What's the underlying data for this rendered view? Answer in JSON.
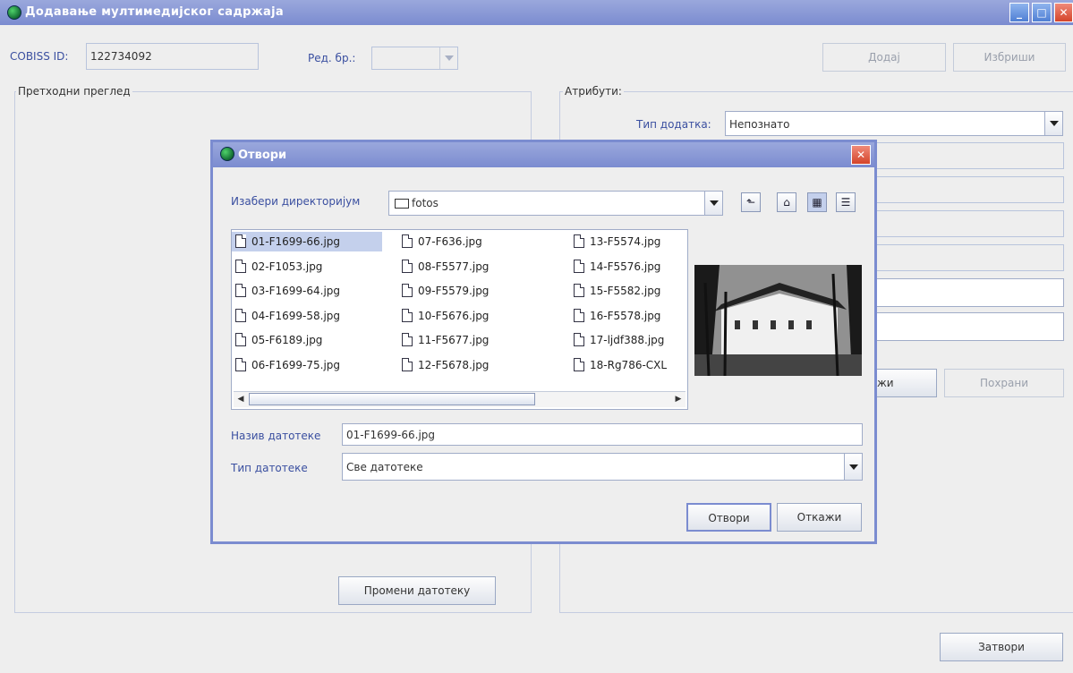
{
  "window": {
    "title": "Додавање мултимедијског садржаја"
  },
  "top": {
    "cobiss_label": "COBISS ID:",
    "cobiss_value": "122734092",
    "red_label": "Ред. бр.:",
    "red_value": "",
    "add_label": "Додај",
    "delete_label": "Избриши"
  },
  "preview": {
    "legend": "Претходни преглед",
    "change_file_label": "Промени датотеку"
  },
  "attributes": {
    "legend": "Атрибути:",
    "type_label": "Тип додатка:",
    "type_value": "Непознато",
    "cancel_partial": "жи",
    "save_label": "Похрани"
  },
  "close_label": "Затвори",
  "dialog": {
    "title": "Отвори",
    "dir_label": "Изабери директоријум",
    "dir_value": "fotos",
    "files": [
      "01-F1699-66.jpg",
      "02-F1053.jpg",
      "03-F1699-64.jpg",
      "04-F1699-58.jpg",
      "05-F6189.jpg",
      "06-F1699-75.jpg",
      "07-F636.jpg",
      "08-F5577.jpg",
      "09-F5579.jpg",
      "10-F5676.jpg",
      "11-F5677.jpg",
      "12-F5678.jpg",
      "13-F5574.jpg",
      "14-F5576.jpg",
      "15-F5582.jpg",
      "16-F5578.jpg",
      "17-ljdf388.jpg",
      "18-Rg786-CXL"
    ],
    "selected_file": "01-F1699-66.jpg",
    "filename_label": "Назив датотеке",
    "filename_value": "01-F1699-66.jpg",
    "filetype_label": "Тип датотеке",
    "filetype_value": "Све датотеке",
    "open_label": "Отвори",
    "cancel_label": "Откажи"
  },
  "colors": {
    "titlebar": "#7b8cd0",
    "label_blue": "#3a4fa0",
    "selection": "#c4d0ec"
  }
}
